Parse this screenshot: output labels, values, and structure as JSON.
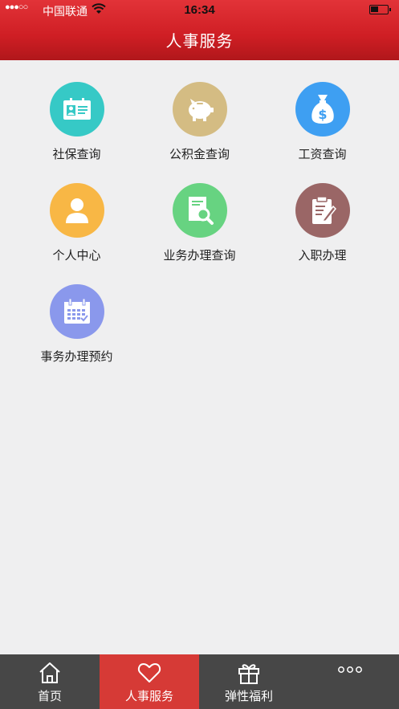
{
  "status_bar": {
    "signal": "●●●○○",
    "carrier": "中国联通",
    "time": "16:34"
  },
  "header": {
    "title": "人事服务"
  },
  "grid": [
    {
      "label": "社保查询",
      "icon": "social-security-card-icon",
      "color": "#36c9c6"
    },
    {
      "label": "公积金查询",
      "icon": "piggy-bank-icon",
      "color": "#d4bc83"
    },
    {
      "label": "工资查询",
      "icon": "money-bag-icon",
      "color": "#3e9ff2"
    },
    {
      "label": "个人中心",
      "icon": "person-icon",
      "color": "#f8b745"
    },
    {
      "label": "业务办理查询",
      "icon": "document-search-icon",
      "color": "#67d381"
    },
    {
      "label": "入职办理",
      "icon": "clipboard-edit-icon",
      "color": "#9a6666"
    },
    {
      "label": "事务办理预约",
      "icon": "calendar-icon",
      "color": "#8a98ec"
    }
  ],
  "tabbar": [
    {
      "label": "首页",
      "icon": "home-icon",
      "active": false
    },
    {
      "label": "人事服务",
      "icon": "heart-icon",
      "active": true
    },
    {
      "label": "弹性福利",
      "icon": "gift-icon",
      "active": false
    },
    {
      "label": "",
      "icon": "more-icon",
      "active": false
    }
  ],
  "colors": {
    "header_red": "#cf1e24",
    "tab_active": "#d63a36",
    "tab_bg": "#474747"
  }
}
